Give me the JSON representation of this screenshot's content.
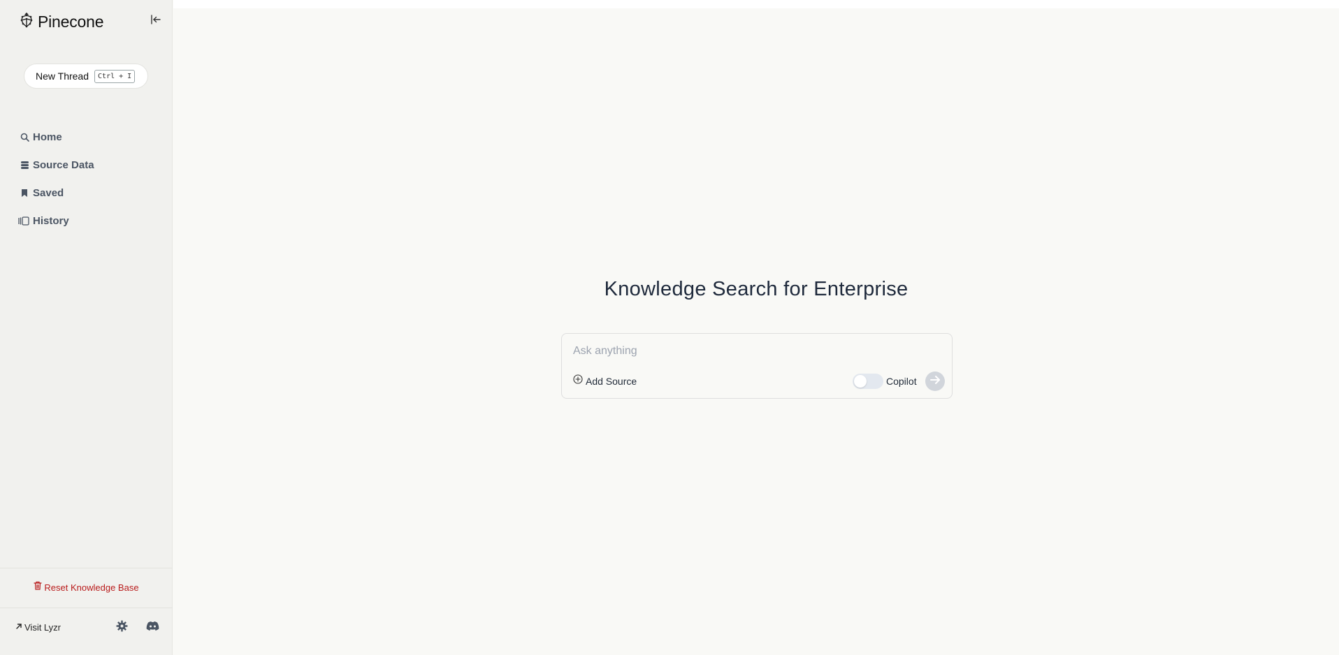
{
  "app": {
    "brand": "Pinecone",
    "icons": {
      "logo": "pinecone-logo-icon",
      "collapse": "collapse-sidebar-icon"
    }
  },
  "sidebar": {
    "new_thread": {
      "label": "New Thread",
      "shortcut": "Ctrl + I"
    },
    "nav": [
      {
        "label": "Home",
        "icon": "search-icon"
      },
      {
        "label": "Source Data",
        "icon": "database-icon"
      },
      {
        "label": "Saved",
        "icon": "bookmark-icon"
      },
      {
        "label": "History",
        "icon": "history-icon"
      }
    ],
    "reset_label": "Reset Knowledge Base",
    "visit_label": "Visit Lyzr",
    "footer_icons": [
      "settings-icon",
      "discord-icon"
    ]
  },
  "main": {
    "title": "Knowledge Search for Enterprise",
    "search": {
      "placeholder": "Ask anything",
      "value": ""
    },
    "add_source_label": "Add Source",
    "copilot_label": "Copilot",
    "copilot_enabled": false
  },
  "colors": {
    "background": "#f9f9f6",
    "sidebar": "#f1f1ee",
    "danger": "#b91c1c",
    "send_disabled": "#d1d5db"
  }
}
